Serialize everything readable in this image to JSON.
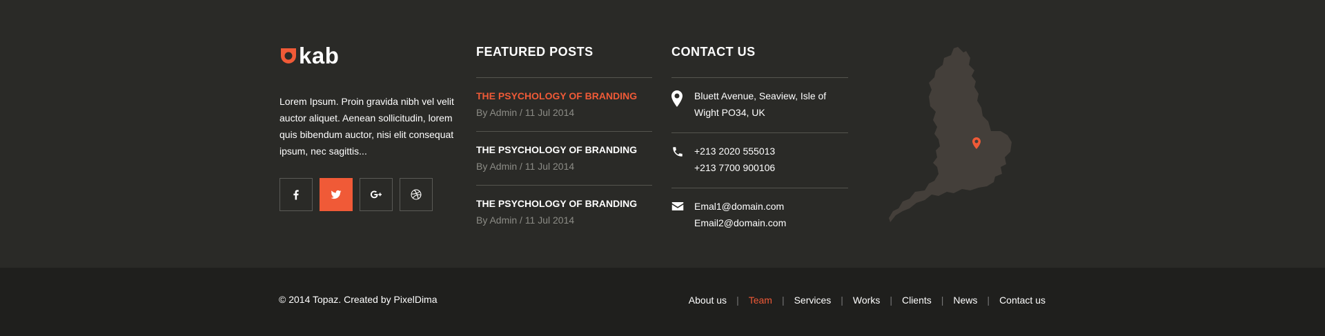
{
  "brand": {
    "logo_text": "kab",
    "accent_color": "#f05a37",
    "about": "Lorem Ipsum. Proin gravida nibh vel velit auctor aliquet. Aenean sollicitudin, lorem quis bibendum auctor, nisi elit consequat ipsum, nec sagittis..."
  },
  "socials": [
    {
      "name": "facebook-icon",
      "active": false
    },
    {
      "name": "twitter-icon",
      "active": true
    },
    {
      "name": "google-plus-icon",
      "active": false
    },
    {
      "name": "dribbble-icon",
      "active": false
    }
  ],
  "featured": {
    "title": "FEATURED POSTS",
    "posts": [
      {
        "title": "THE PSYCHOLOGY OF BRANDING",
        "meta": "By Admin / 11 Jul 2014"
      },
      {
        "title": "THE PSYCHOLOGY OF BRANDING",
        "meta": "By Admin / 11 Jul 2014"
      },
      {
        "title": "THE PSYCHOLOGY OF BRANDING",
        "meta": "By Admin / 11 Jul 2014"
      }
    ]
  },
  "contact": {
    "title": "CONTACT US",
    "address_line1": "Bluett Avenue, Seaview, Isle of",
    "address_line2": "Wight PO34, UK",
    "phone1": "+213 2020 555013",
    "phone2": "+213 7700 900106",
    "email1": "Emal1@domain.com",
    "email2": "Email2@domain.com"
  },
  "footer": {
    "copyright": "© 2014 Topaz. Created by PixelDima",
    "nav": [
      {
        "label": "About us",
        "active": false
      },
      {
        "label": "Team",
        "active": true
      },
      {
        "label": "Services",
        "active": false
      },
      {
        "label": "Works",
        "active": false
      },
      {
        "label": "Clients",
        "active": false
      },
      {
        "label": "News",
        "active": false
      },
      {
        "label": "Contact us",
        "active": false
      }
    ],
    "separator": "|"
  }
}
